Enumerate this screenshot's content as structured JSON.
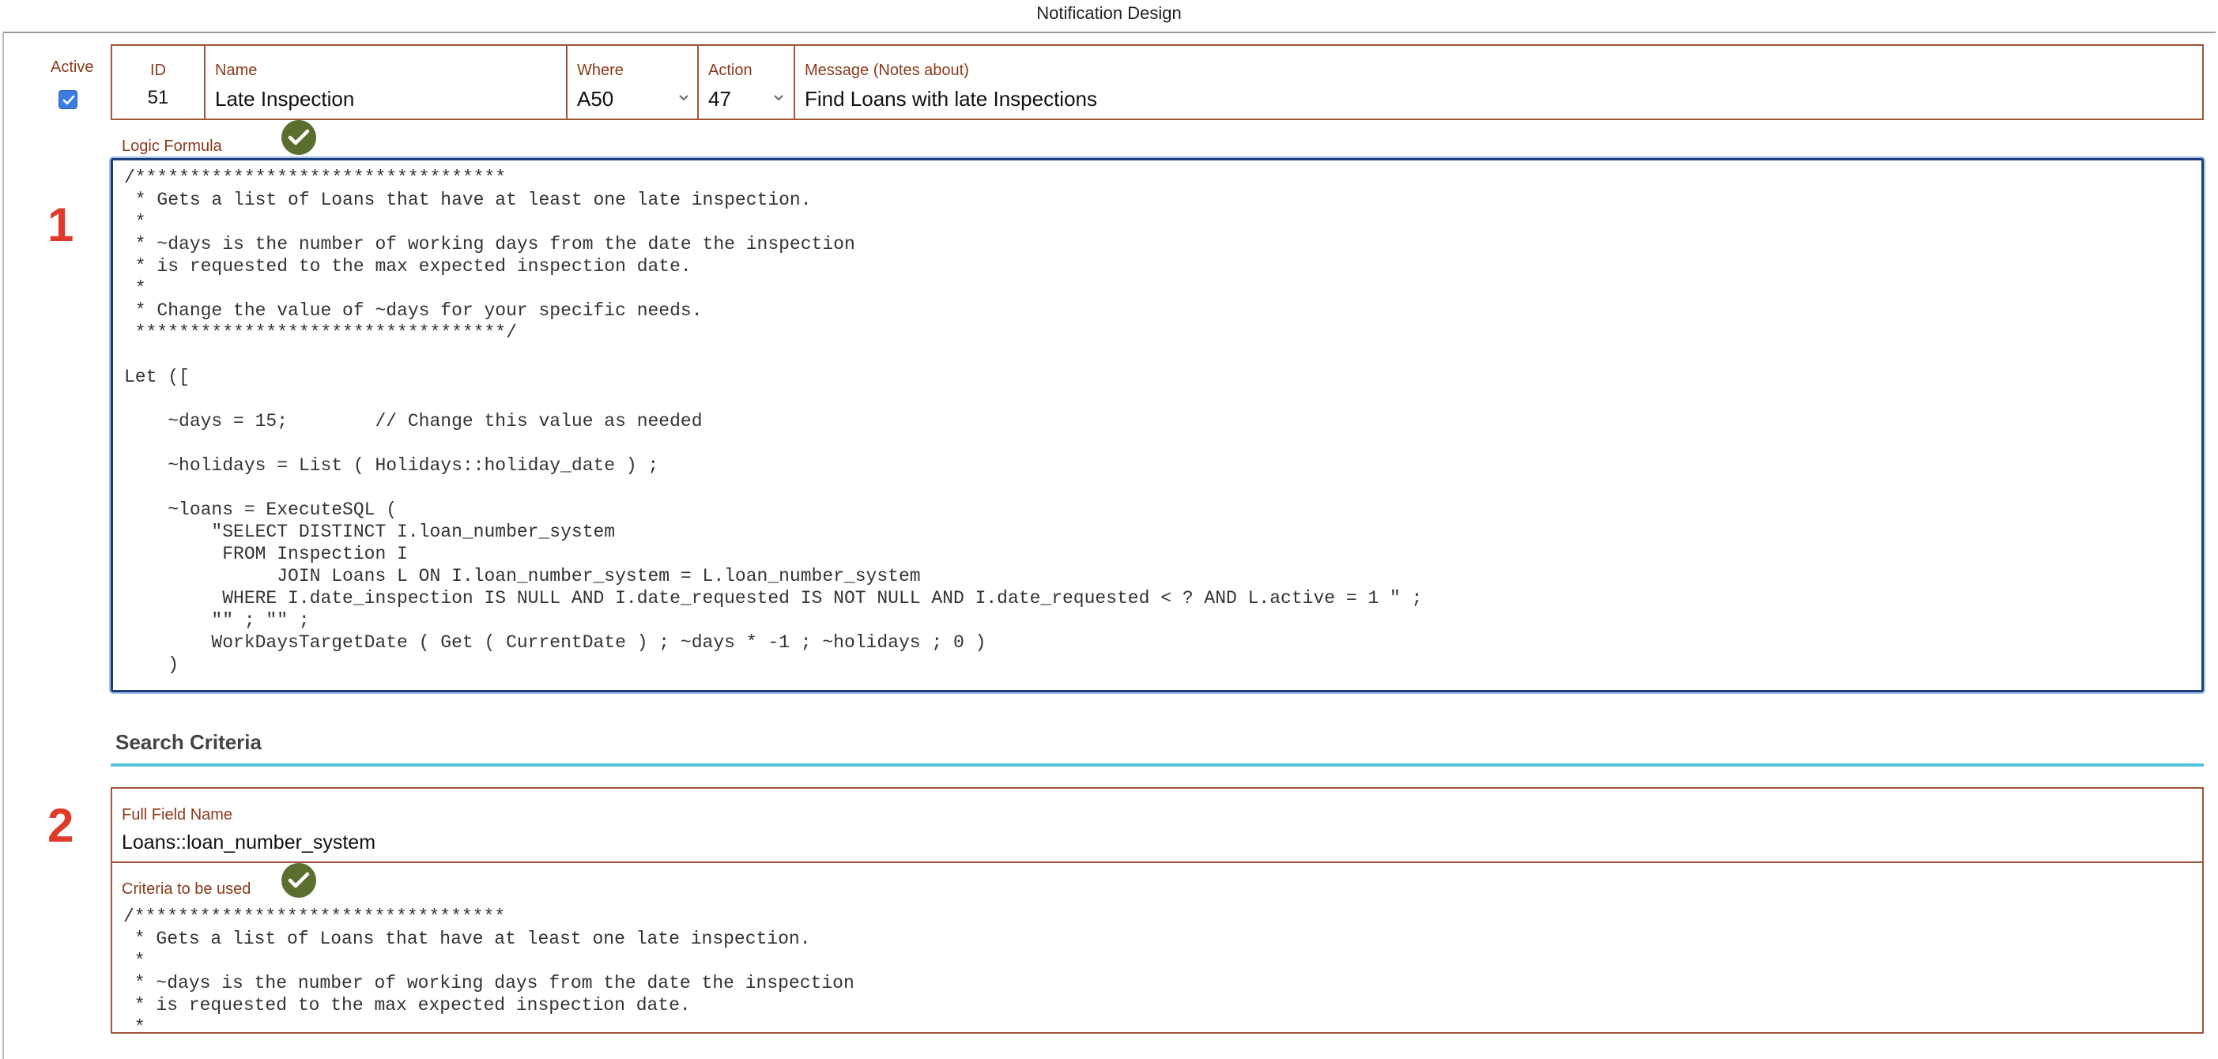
{
  "window": {
    "title": "Notification Design"
  },
  "header": {
    "active_label": "Active",
    "active_checked": true,
    "id_label": "ID",
    "id_value": "51",
    "name_label": "Name",
    "name_value": "Late Inspection",
    "where_label": "Where",
    "where_value": "A50",
    "action_label": "Action",
    "action_value": "47",
    "message_label": "Message (Notes about)",
    "message_value": "Find Loans with late Inspections"
  },
  "logic": {
    "label": "Logic Formula",
    "code": "/**********************************\n * Gets a list of Loans that have at least one late inspection.\n *\n * ~days is the number of working days from the date the inspection\n * is requested to the max expected inspection date.\n *\n * Change the value of ~days for your specific needs.\n **********************************/\n\nLet ([\n\n    ~days = 15;        // Change this value as needed\n\n    ~holidays = List ( Holidays::holiday_date ) ;\n\n    ~loans = ExecuteSQL (\n        \"SELECT DISTINCT I.loan_number_system\n         FROM Inspection I\n              JOIN Loans L ON I.loan_number_system = L.loan_number_system\n         WHERE I.date_inspection IS NULL AND I.date_requested IS NOT NULL AND I.date_requested < ? AND L.active = 1 \" ;\n        \"\" ; \"\" ;\n        WorkDaysTargetDate ( Get ( CurrentDate ) ; ~days * -1 ; ~holidays ; 0 )\n    )"
  },
  "markers": {
    "one": "1",
    "two": "2"
  },
  "search": {
    "title": "Search Criteria",
    "full_field_label": "Full Field Name",
    "full_field_value": "Loans::loan_number_system",
    "criteria_label": "Criteria to be used",
    "criteria_code": "/**********************************\n * Gets a list of Loans that have at least one late inspection.\n *\n * ~days is the number of working days from the date the inspection\n * is requested to the max expected inspection date.\n *"
  },
  "colors": {
    "label": "#8b3a1a",
    "field_border": "#a0553a",
    "marker": "#e03a2a",
    "ok_icon": "#5a6e2d",
    "accent_rule": "#4ec3dc",
    "checkbox": "#3b7de0"
  },
  "icons": {
    "ok": "check-circle-icon",
    "dropdown": "chevron-down-icon",
    "checkbox": "checkbox-checked-icon"
  }
}
